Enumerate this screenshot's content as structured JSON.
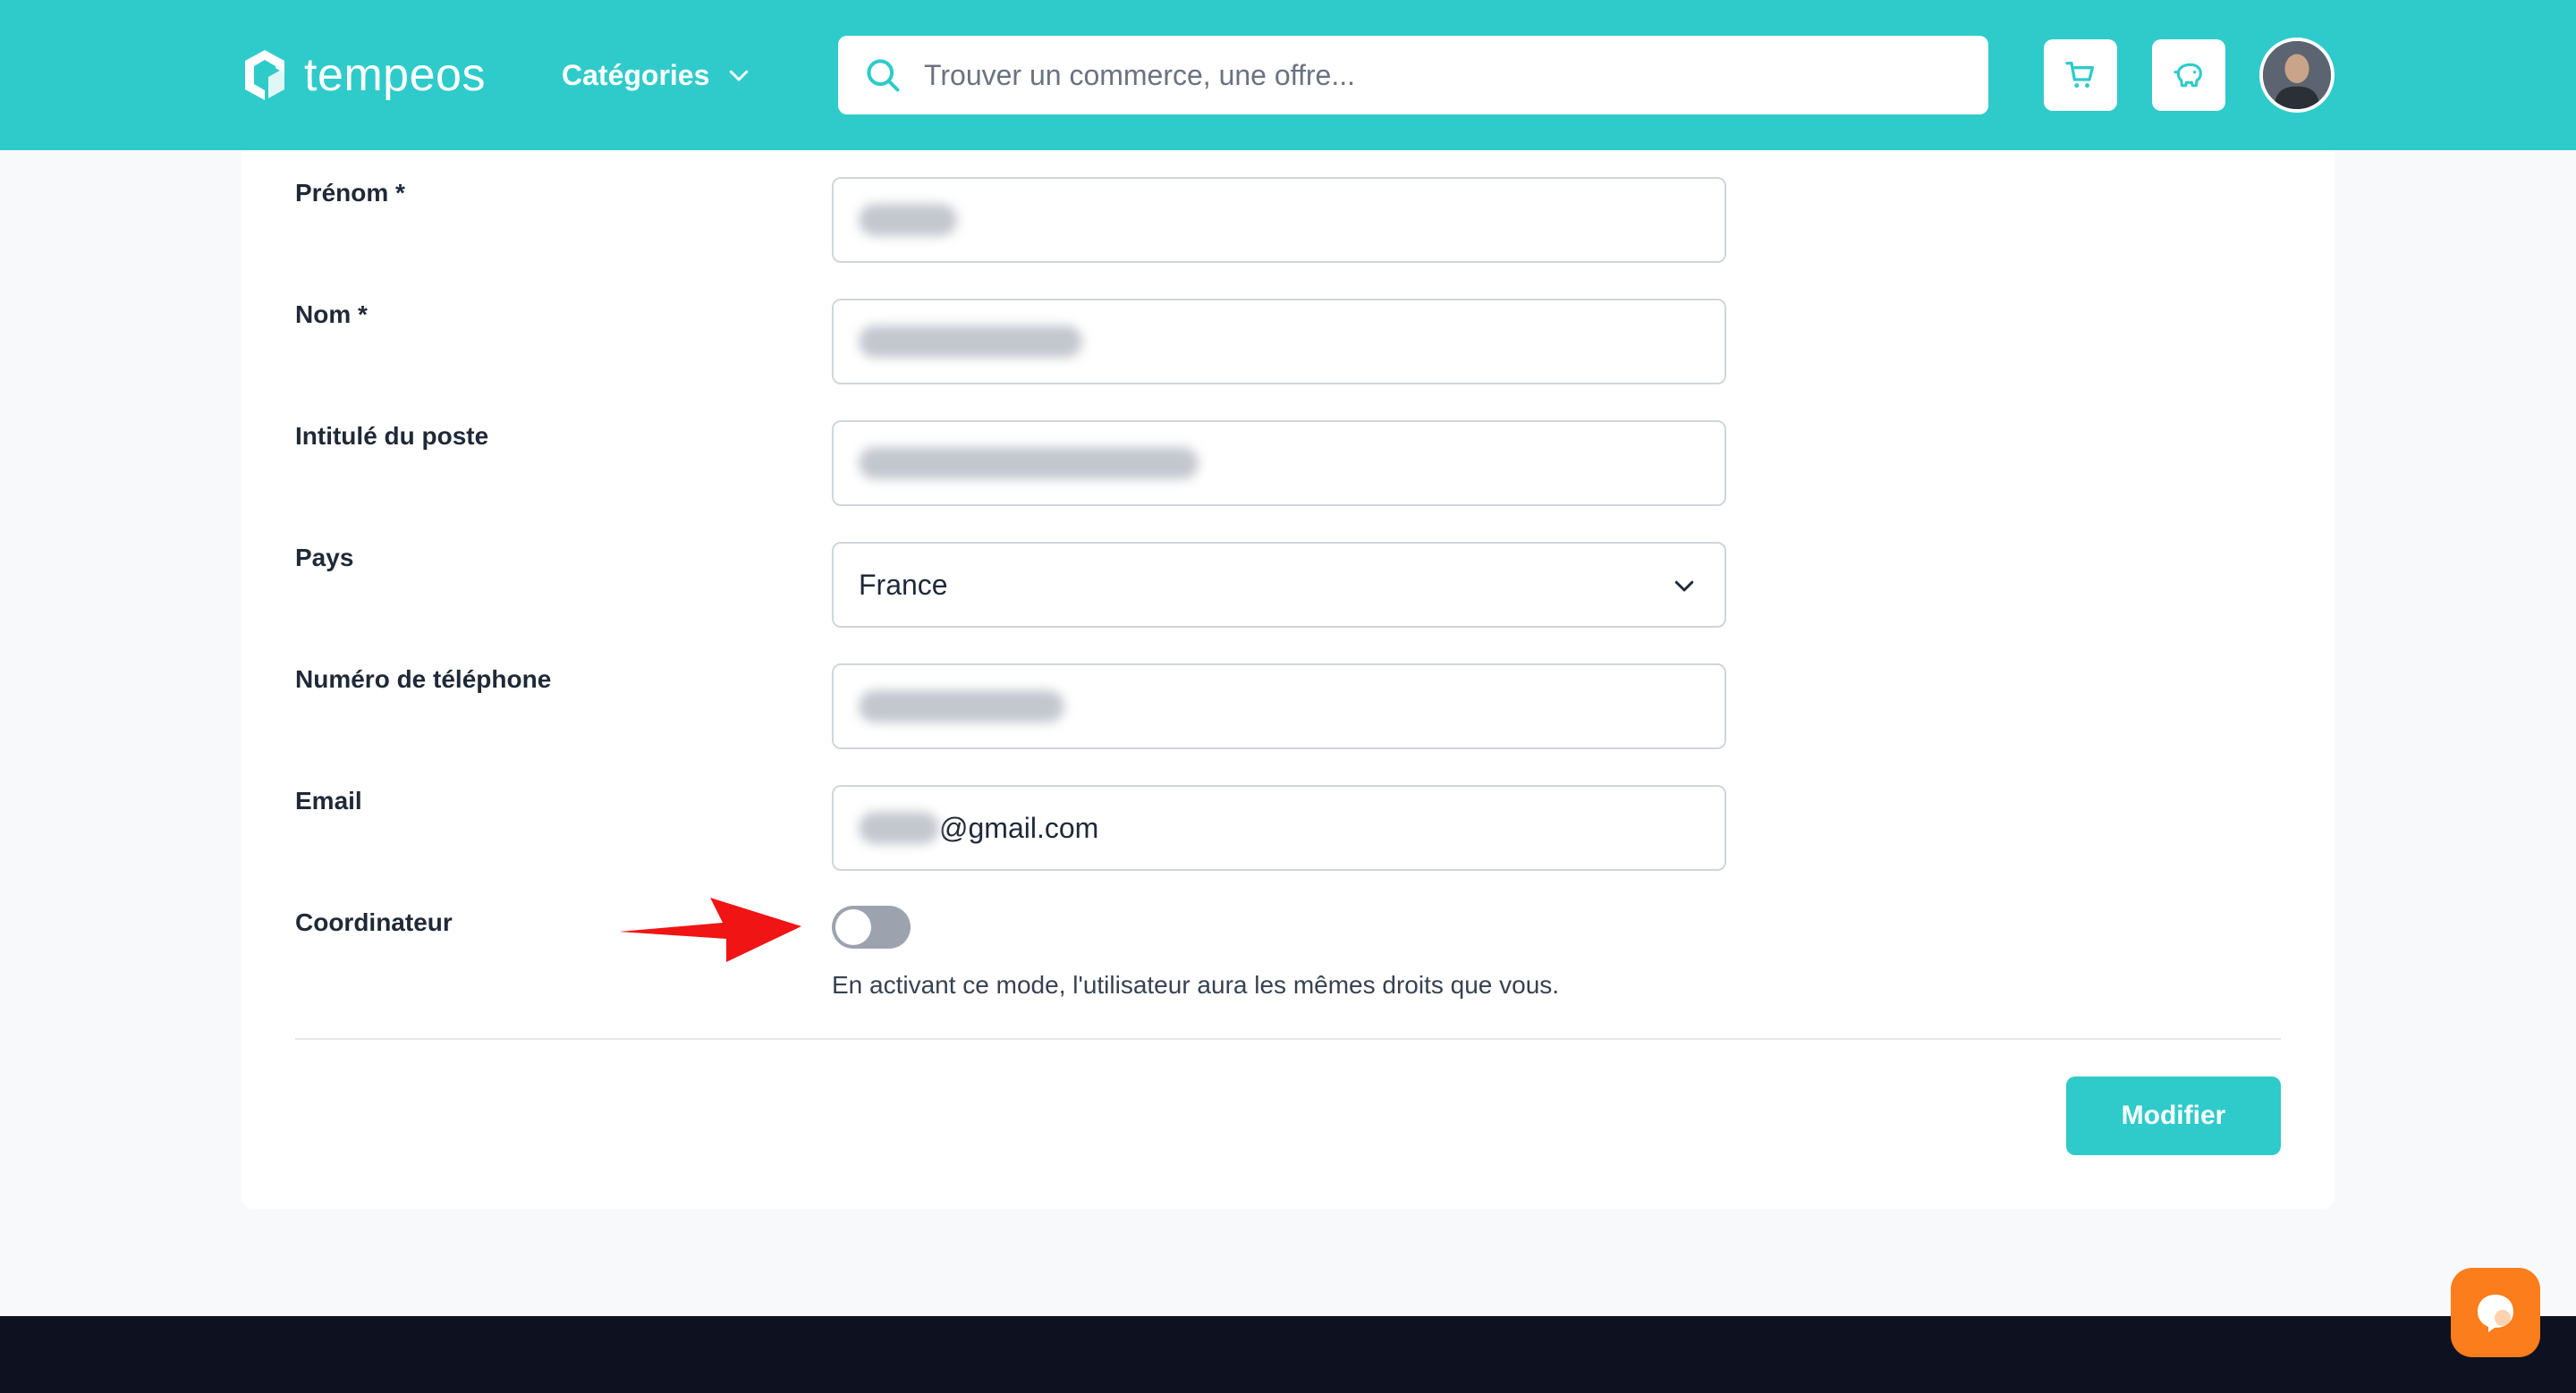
{
  "header": {
    "logo_text": "tempeos",
    "categories_label": "Catégories",
    "search_placeholder": "Trouver un commerce, une offre..."
  },
  "form": {
    "first_name": {
      "label": "Prénom *"
    },
    "last_name": {
      "label": "Nom *"
    },
    "job_title": {
      "label": "Intitulé du poste"
    },
    "country": {
      "label": "Pays",
      "value": "France"
    },
    "phone": {
      "label": "Numéro de téléphone"
    },
    "email": {
      "label": "Email",
      "value_suffix": "@gmail.com"
    },
    "coordinator": {
      "label": "Coordinateur",
      "enabled": false,
      "helper": "En activant ce mode, l'utilisateur aura les mêmes droits que vous."
    },
    "submit_label": "Modifier"
  },
  "colors": {
    "brand": "#2fcbcb",
    "annotation_arrow": "#f01414",
    "chat": "#fb7d1b",
    "footer": "#0e1220"
  }
}
